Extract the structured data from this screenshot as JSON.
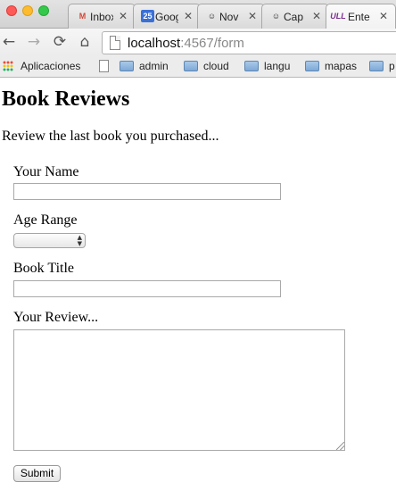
{
  "browser": {
    "tabs": [
      {
        "favicon": "M",
        "title": "Inbox",
        "active": false,
        "favicon_color": "#d44638"
      },
      {
        "favicon": "25",
        "title": "Google",
        "active": false,
        "favicon_color": "#3b6fd6"
      },
      {
        "favicon": "☺",
        "title": "Nov",
        "active": false,
        "favicon_color": "#444444"
      },
      {
        "favicon": "☺",
        "title": "Cap",
        "active": false,
        "favicon_color": "#444444"
      },
      {
        "favicon": "ULL",
        "title": "Ente",
        "active": false,
        "favicon_color": "#7b2d8e"
      }
    ],
    "nav": {
      "back_icon": "←",
      "forward_icon": "→",
      "reload_icon": "⟳",
      "home_icon": "⌂"
    },
    "url": {
      "host": "localhost",
      "path": ":4567/form"
    },
    "bookmarks": [
      {
        "label": "Aplicaciones",
        "icon": "apps-icon"
      },
      {
        "label": "",
        "icon": "file-icon"
      },
      {
        "label": "admin",
        "icon": "folder-icon"
      },
      {
        "label": "cloud",
        "icon": "folder-icon"
      },
      {
        "label": "langu",
        "icon": "folder-icon"
      },
      {
        "label": "mapas",
        "icon": "folder-icon"
      },
      {
        "label": "p",
        "icon": "folder-icon"
      }
    ]
  },
  "page": {
    "title": "Book Reviews",
    "intro": "Review the last book you purchased...",
    "form": {
      "name_label": "Your Name",
      "name_value": "",
      "age_label": "Age Range",
      "age_selected": "",
      "title_label": "Book Title",
      "title_value": "",
      "review_label": "Your Review...",
      "review_value": "",
      "submit_label": "Submit"
    }
  }
}
